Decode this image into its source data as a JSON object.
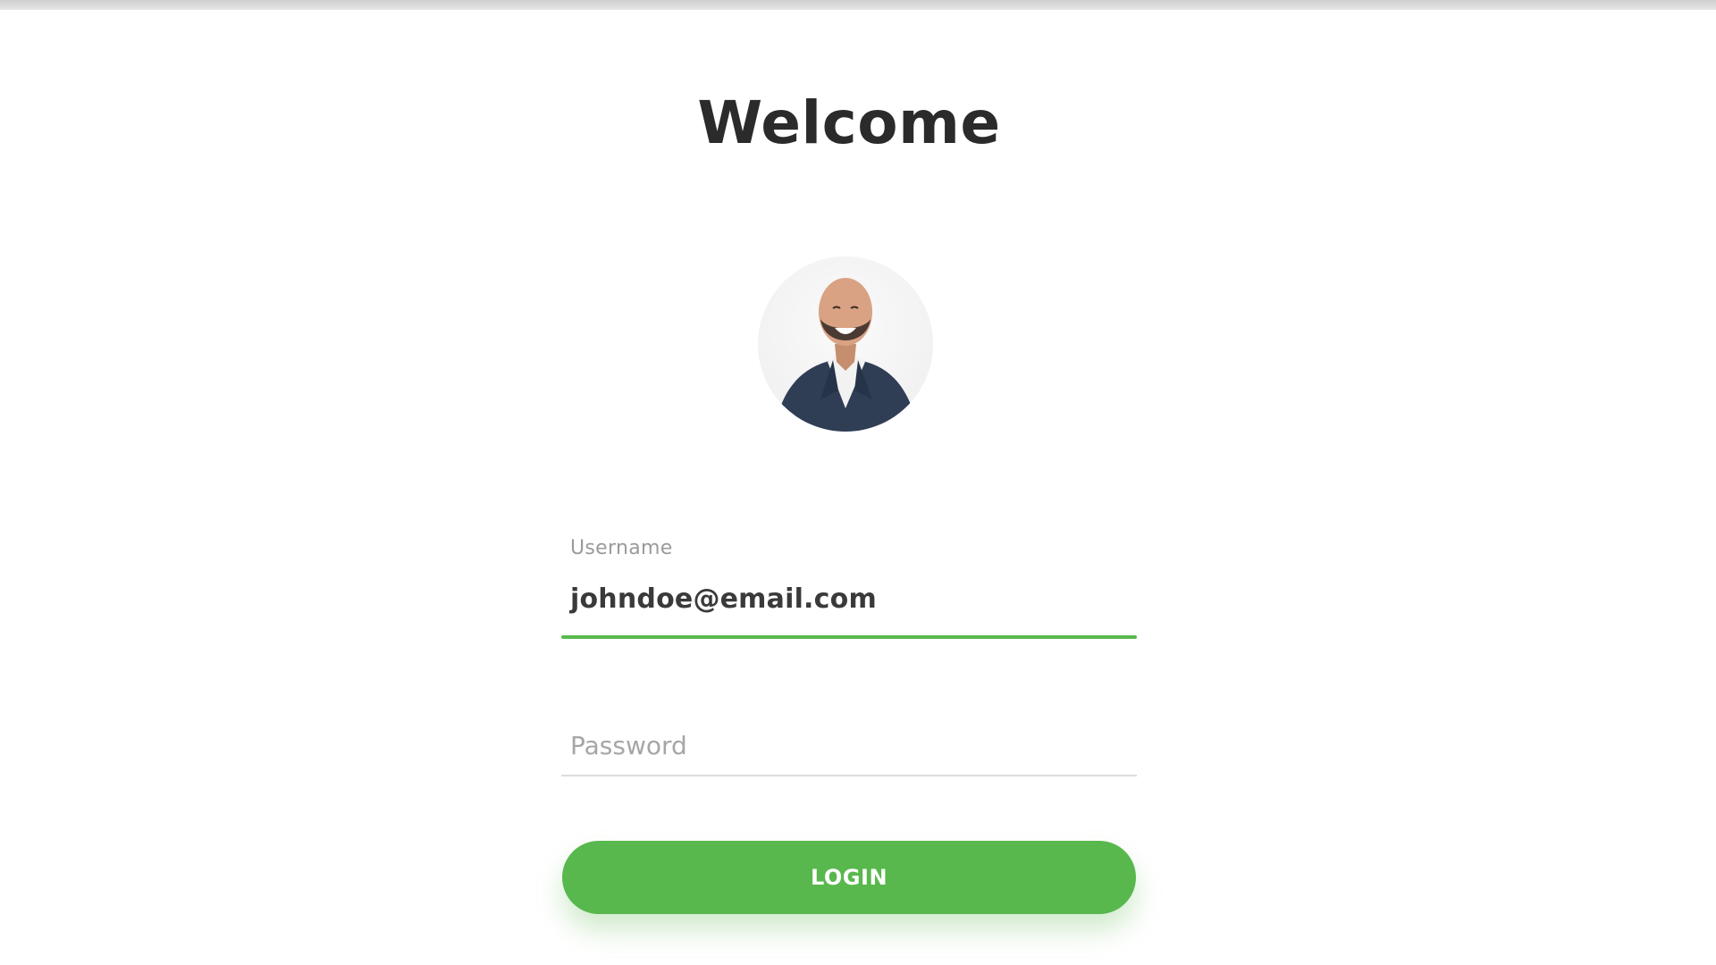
{
  "header": {
    "title": "Welcome"
  },
  "profile": {
    "avatar_alt": "user profile photo"
  },
  "form": {
    "username": {
      "label": "Username",
      "value": "johndoe@email.com"
    },
    "password": {
      "placeholder": "Password",
      "value": ""
    },
    "login_label": "LOGIN"
  },
  "colors": {
    "accent": "#58b84d",
    "title_text": "#2b2b2b",
    "label_text": "#9a9a9a",
    "input_text": "#3a3a3a",
    "divider": "#dcdcdc",
    "background": "#ffffff"
  },
  "icons": {
    "avatar": "avatar-photo"
  }
}
